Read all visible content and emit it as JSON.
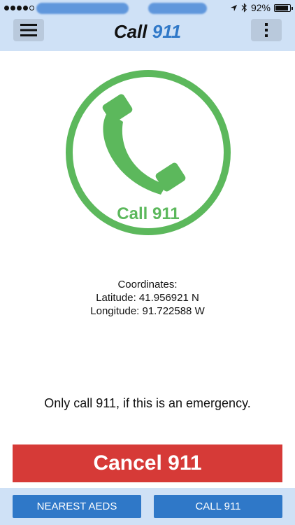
{
  "status": {
    "battery": "92%",
    "battery_level": 0.92
  },
  "navbar": {
    "title_main": "Call ",
    "title_accent": "911"
  },
  "logo": {
    "label": "Call 911",
    "color": "#5cb85c"
  },
  "coordinates": {
    "heading": "Coordinates:",
    "latitude": "Latitude: 41.956921 N",
    "longitude": "Longitude: 91.722588 W"
  },
  "warning": "Only call 911, if this is an emergency.",
  "cancel_button": "Cancel 911",
  "bottom": {
    "nearest_aeds": "NEAREST AEDS",
    "call_911": "CALL 911"
  },
  "colors": {
    "bar_bg": "#cfe1f6",
    "accent": "#2f78c8",
    "danger": "#d63a37",
    "logo_green": "#5cb85c"
  }
}
